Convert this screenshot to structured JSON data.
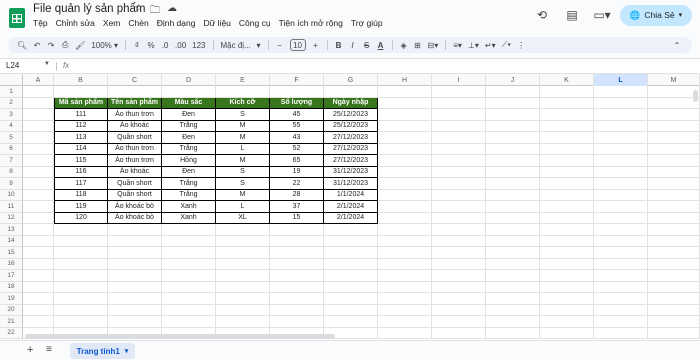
{
  "doc": {
    "title": "File quản lý sản phẩm"
  },
  "menu": [
    "Tệp",
    "Chỉnh sửa",
    "Xem",
    "Chèn",
    "Định dạng",
    "Dữ liệu",
    "Công cụ",
    "Tiện ích mở rộng",
    "Trợ giúp"
  ],
  "share_label": "Chia Sẻ",
  "toolbar": {
    "zoom": "100%",
    "currency": "₫",
    "percent": "%",
    "dec_less": ".0",
    "dec_more": ".00",
    "num_format": "123",
    "font": "Mặc đị...",
    "font_size": "10",
    "bold": "B",
    "italic": "I",
    "strike": "S",
    "text_color": "A"
  },
  "formula_bar": {
    "cell_ref": "L24",
    "fx": "fx"
  },
  "columns": [
    "A",
    "B",
    "C",
    "D",
    "E",
    "F",
    "G",
    "H",
    "I",
    "J",
    "K",
    "L",
    "M"
  ],
  "row_numbers": [
    "1",
    "2",
    "3",
    "4",
    "5",
    "6",
    "7",
    "8",
    "9",
    "10",
    "11",
    "12",
    "13",
    "14",
    "15",
    "16",
    "17",
    "18",
    "19",
    "20",
    "21",
    "22"
  ],
  "table": {
    "headers": [
      "Mã sản phẩm",
      "Tên sản phẩm",
      "Màu sắc",
      "Kích cỡ",
      "Số lượng",
      "Ngày nhập"
    ],
    "rows": [
      [
        "111",
        "Áo thun trơn",
        "Đen",
        "S",
        "45",
        "25/12/2023"
      ],
      [
        "112",
        "Áo khoác",
        "Trắng",
        "M",
        "55",
        "25/12/2023"
      ],
      [
        "113",
        "Quần short",
        "Đen",
        "M",
        "43",
        "27/12/2023"
      ],
      [
        "114",
        "Áo thun trơn",
        "Trắng",
        "L",
        "52",
        "27/12/2023"
      ],
      [
        "115",
        "Áo thun trơn",
        "Hồng",
        "M",
        "65",
        "27/12/2023"
      ],
      [
        "116",
        "Áo khoác",
        "Đen",
        "S",
        "19",
        "31/12/2023"
      ],
      [
        "117",
        "Quần short",
        "Trắng",
        "S",
        "22",
        "31/12/2023"
      ],
      [
        "118",
        "Quần short",
        "Trắng",
        "M",
        "28",
        "1/1/2024"
      ],
      [
        "119",
        "Áo khoác bò",
        "Xanh",
        "L",
        "37",
        "2/1/2024"
      ],
      [
        "120",
        "Áo khoác bò",
        "Xanh",
        "XL",
        "15",
        "2/1/2024"
      ]
    ]
  },
  "sheet_tab": "Trang tính1",
  "colors": {
    "header_fill": "#38761d",
    "share_bg": "#c2e7ff",
    "accent": "#0b57d0"
  }
}
